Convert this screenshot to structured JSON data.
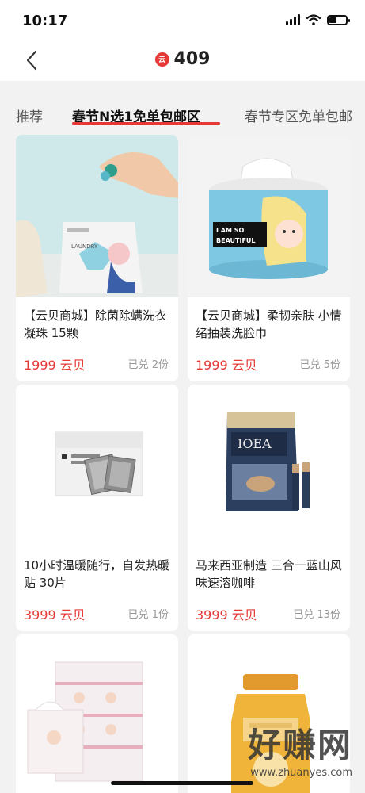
{
  "status": {
    "time": "10:17"
  },
  "nav": {
    "back_icon": "chevron-left-icon",
    "coin_icon": "yunbei-coin-icon",
    "coin_badge_text": "云",
    "coin_balance": "409"
  },
  "tabs": [
    {
      "label": "推荐",
      "active": false
    },
    {
      "label": "春节N选1免单包邮区",
      "active": true
    },
    {
      "label": "春节专区免单包邮",
      "active": false
    }
  ],
  "products": [
    {
      "title": "【云贝商城】除菌除螨洗衣凝珠 15颗",
      "price": "1999 云贝",
      "sold": "已兑 2份"
    },
    {
      "title": "【云贝商城】柔韧亲肤 小情绪抽装洗脸巾",
      "price": "1999 云贝",
      "sold": "已兑 5份",
      "image_text": [
        "I AM SO",
        "BEAUTIFUL"
      ]
    },
    {
      "title": "10小时温暖随行，自发热暖贴 30片",
      "price": "3999 云贝",
      "sold": "已兑 1份"
    },
    {
      "title": "马来西亚制造 三合一蓝山风味速溶咖啡",
      "price": "3999 云贝",
      "sold": "已兑 13份",
      "image_text": [
        "IOEA"
      ]
    },
    {
      "title": "",
      "price": "",
      "sold": ""
    },
    {
      "title": "",
      "price": "",
      "sold": ""
    }
  ],
  "watermark": {
    "main": "好赚网",
    "sub": "www.zhuanyes.com"
  },
  "colors": {
    "accent": "#e53935",
    "background": "#f2f2f2",
    "card": "#ffffff",
    "muted": "#999999"
  }
}
